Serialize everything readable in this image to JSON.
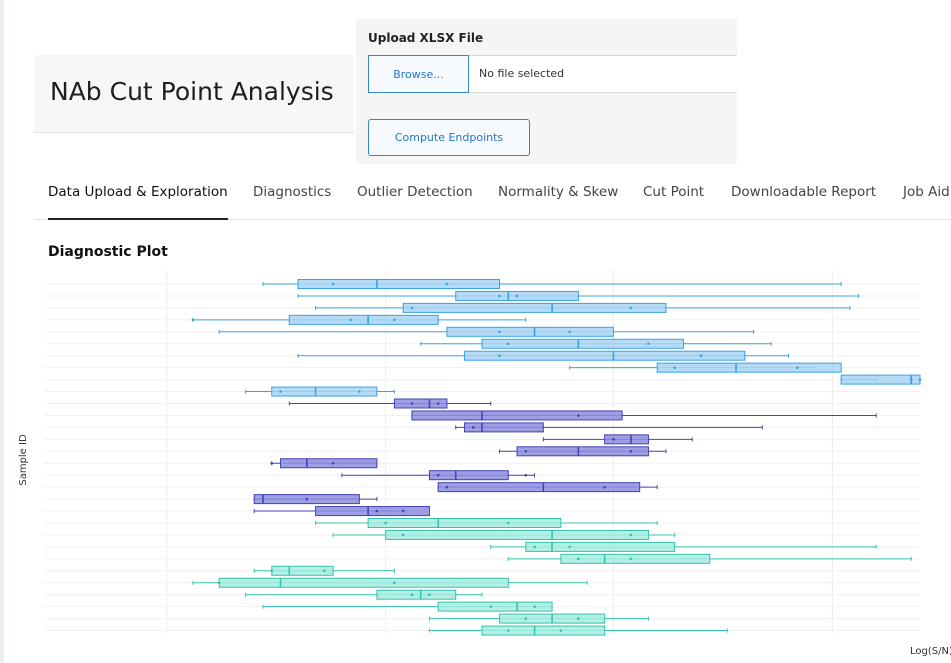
{
  "app": {
    "title": "NAb Cut Point Analysis"
  },
  "upload": {
    "label": "Upload XLSX File",
    "browse_label": "Browse...",
    "file_status": "No file selected",
    "compute_label": "Compute Endpoints"
  },
  "tabs": [
    {
      "label": "Data Upload & Exploration",
      "active": true
    },
    {
      "label": "Diagnostics"
    },
    {
      "label": "Outlier Detection"
    },
    {
      "label": "Normality & Skew"
    },
    {
      "label": "Cut Point"
    },
    {
      "label": "Downloadable Report"
    },
    {
      "label": "Job Aid"
    }
  ],
  "plot_title": "Diagnostic Plot",
  "colors": {
    "accent": "#2f87cc",
    "blue_fill": "#a9d5f5",
    "blue_line": "#3aa3e0",
    "purple_fill": "#8d8de0",
    "purple_line": "#4343b5",
    "teal_fill": "#a6ece0",
    "teal_line": "#35c3ad"
  },
  "chart_data": {
    "type": "boxplot",
    "xlabel": "Log(S/N)",
    "ylabel": "Sample ID",
    "grid": true,
    "rows": [
      {
        "group": "blue",
        "w": [
          0.25,
          0.91
        ],
        "b": [
          0.29,
          0.52
        ],
        "m": 0.38,
        "pts": [
          0.33,
          0.46
        ]
      },
      {
        "group": "blue",
        "w": [
          0.29,
          0.93
        ],
        "b": [
          0.47,
          0.61
        ],
        "m": 0.53,
        "pts": [
          0.52,
          0.54
        ]
      },
      {
        "group": "blue",
        "w": [
          0.31,
          0.92
        ],
        "b": [
          0.41,
          0.71
        ],
        "m": 0.58,
        "pts": [
          0.42,
          0.67
        ]
      },
      {
        "group": "blue",
        "w": [
          0.17,
          0.55
        ],
        "b": [
          0.28,
          0.45
        ],
        "m": 0.37,
        "pts": [
          0.17,
          0.35,
          0.4
        ]
      },
      {
        "group": "blue",
        "w": [
          0.2,
          0.81
        ],
        "b": [
          0.46,
          0.65
        ],
        "m": 0.56,
        "pts": [
          0.52,
          0.6
        ]
      },
      {
        "group": "blue",
        "w": [
          0.43,
          0.83
        ],
        "b": [
          0.5,
          0.73
        ],
        "m": 0.61,
        "pts": [
          0.53,
          0.69
        ]
      },
      {
        "group": "blue",
        "w": [
          0.29,
          0.85
        ],
        "b": [
          0.48,
          0.8
        ],
        "m": 0.65,
        "pts": [
          0.52,
          0.75
        ]
      },
      {
        "group": "blue",
        "w": [
          0.6,
          0.88
        ],
        "b": [
          0.7,
          0.91
        ],
        "m": 0.79,
        "pts": [
          0.72,
          0.86
        ]
      },
      {
        "group": "blue",
        "w": [
          0.91,
          0.95
        ],
        "b": [
          0.91,
          1.0
        ],
        "m": 0.99,
        "pts": [
          0.99,
          1.0
        ]
      },
      {
        "group": "blue",
        "w": [
          0.23,
          0.4
        ],
        "b": [
          0.26,
          0.38
        ],
        "m": 0.31,
        "pts": [
          0.27,
          0.36
        ]
      },
      {
        "group": "purple",
        "w": [
          0.28,
          0.51
        ],
        "b": [
          0.4,
          0.46
        ],
        "m": 0.44,
        "pts": [
          0.42,
          0.45
        ]
      },
      {
        "group": "purple",
        "w": [
          0.42,
          0.95
        ],
        "b": [
          0.42,
          0.66
        ],
        "m": 0.5,
        "pts": [
          0.61
        ]
      },
      {
        "group": "purple",
        "w": [
          0.47,
          0.82
        ],
        "b": [
          0.48,
          0.57
        ],
        "m": 0.5,
        "pts": [
          0.49
        ]
      },
      {
        "group": "purple",
        "w": [
          0.57,
          0.74
        ],
        "b": [
          0.64,
          0.69
        ],
        "m": 0.67,
        "pts": [
          0.65
        ]
      },
      {
        "group": "purple",
        "w": [
          0.52,
          0.71
        ],
        "b": [
          0.54,
          0.69
        ],
        "m": 0.61,
        "pts": [
          0.55,
          0.67
        ]
      },
      {
        "group": "purple",
        "w": [
          0.26,
          0.38
        ],
        "b": [
          0.27,
          0.38
        ],
        "m": 0.3,
        "pts": [
          0.26,
          0.33
        ]
      },
      {
        "group": "purple",
        "w": [
          0.34,
          0.56
        ],
        "b": [
          0.44,
          0.53
        ],
        "m": 0.47,
        "pts": [
          0.45,
          0.55
        ]
      },
      {
        "group": "purple",
        "w": [
          0.45,
          0.7
        ],
        "b": [
          0.45,
          0.68
        ],
        "m": 0.57,
        "pts": [
          0.46,
          0.64
        ]
      },
      {
        "group": "purple",
        "w": [
          0.24,
          0.38
        ],
        "b": [
          0.24,
          0.36
        ],
        "m": 0.25,
        "pts": [
          0.3
        ]
      },
      {
        "group": "purple",
        "w": [
          0.24,
          0.41
        ],
        "b": [
          0.31,
          0.44
        ],
        "m": 0.37,
        "pts": [
          0.38,
          0.41
        ]
      },
      {
        "group": "teal",
        "w": [
          0.31,
          0.7
        ],
        "b": [
          0.37,
          0.59
        ],
        "m": 0.45,
        "pts": [
          0.39,
          0.53
        ]
      },
      {
        "group": "teal",
        "w": [
          0.33,
          0.72
        ],
        "b": [
          0.39,
          0.69
        ],
        "m": 0.58,
        "pts": [
          0.41,
          0.67
        ]
      },
      {
        "group": "teal",
        "w": [
          0.51,
          0.95
        ],
        "b": [
          0.55,
          0.72
        ],
        "m": 0.58,
        "pts": [
          0.56,
          0.6
        ]
      },
      {
        "group": "teal",
        "w": [
          0.53,
          0.99
        ],
        "b": [
          0.59,
          0.76
        ],
        "m": 0.64,
        "pts": [
          0.61,
          0.67
        ]
      },
      {
        "group": "teal",
        "w": [
          0.24,
          0.4
        ],
        "b": [
          0.26,
          0.33
        ],
        "m": 0.28,
        "pts": [
          0.26,
          0.32
        ]
      },
      {
        "group": "teal",
        "w": [
          0.17,
          0.62
        ],
        "b": [
          0.2,
          0.53
        ],
        "m": 0.27,
        "pts": [
          0.2,
          0.4
        ]
      },
      {
        "group": "teal",
        "w": [
          0.23,
          0.5
        ],
        "b": [
          0.38,
          0.47
        ],
        "m": 0.43,
        "pts": [
          0.42,
          0.44
        ]
      },
      {
        "group": "teal",
        "w": [
          0.25,
          0.58
        ],
        "b": [
          0.45,
          0.58
        ],
        "m": 0.54,
        "pts": [
          0.51,
          0.56
        ]
      },
      {
        "group": "teal",
        "w": [
          0.44,
          0.69
        ],
        "b": [
          0.52,
          0.64
        ],
        "m": 0.58,
        "pts": [
          0.55,
          0.61
        ]
      },
      {
        "group": "teal",
        "w": [
          0.44,
          0.78
        ],
        "b": [
          0.5,
          0.64
        ],
        "m": 0.56,
        "pts": [
          0.53,
          0.59
        ]
      }
    ]
  }
}
